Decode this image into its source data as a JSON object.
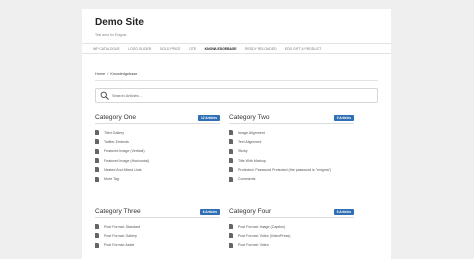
{
  "site": {
    "title": "Demo Site",
    "tagline": "Test area for Enigma"
  },
  "nav": {
    "items": [
      {
        "label": "WP CATALOGUE",
        "active": false
      },
      {
        "label": "LOGO SLIDER",
        "active": false
      },
      {
        "label": "GOLD PRICE",
        "active": false
      },
      {
        "label": "OTE",
        "active": false
      },
      {
        "label": "KNOWLEDGEBASE",
        "active": true
      },
      {
        "label": "REDDY RELOADED",
        "active": false
      },
      {
        "label": "EDD GIFT A PRODUCT",
        "active": false
      }
    ]
  },
  "breadcrumb": {
    "home": "Home",
    "separator": "/",
    "current": "Knowledgebase"
  },
  "search": {
    "placeholder": "Search Articles..."
  },
  "colors": {
    "badge": "#2f6fb4",
    "background": "#efefef"
  },
  "categories": [
    {
      "title": "Category One",
      "badge": "12 Articles",
      "articles": [
        "Tiled Gallery",
        "Twitter Embeds",
        "Featured Image (Vertical)",
        "Featured Image (Horizontal)",
        "Nested And Mixed Lists",
        "More Tag"
      ]
    },
    {
      "title": "Category Two",
      "badge": "9 Articles",
      "articles": [
        "Image Alignment",
        "Text Alignment",
        "Sticky",
        "Title With Markup",
        "Protected: Password Protected (the password is \"enigma\")",
        "Comments"
      ]
    },
    {
      "title": "Category Three",
      "badge": "6 Articles",
      "articles": [
        "Post Format: Standard",
        "Post Format: Gallery",
        "Post Format: Aside"
      ]
    },
    {
      "title": "Category Four",
      "badge": "6 Articles",
      "articles": [
        "Post Format: Image (Caption)",
        "Post Format: Video (VideoPress)",
        "Post Format: Video"
      ]
    }
  ]
}
